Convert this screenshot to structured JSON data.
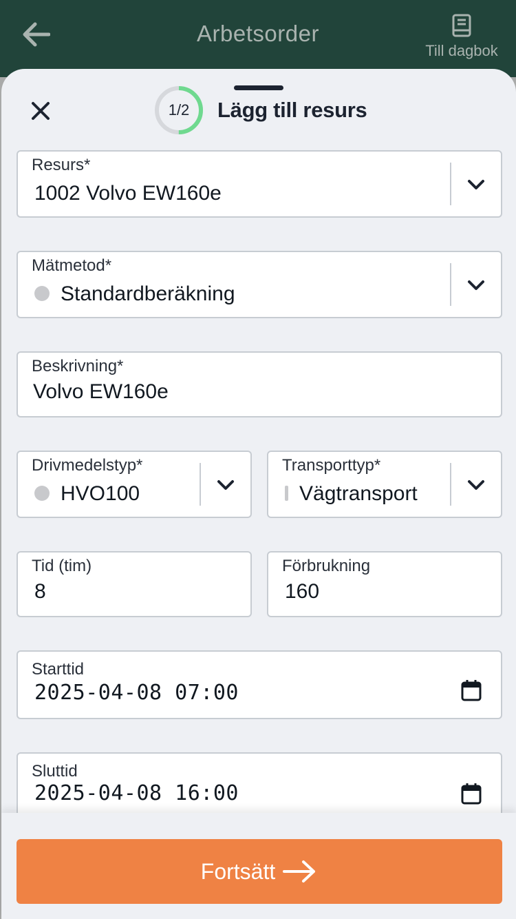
{
  "appbar": {
    "title": "Arbetsorder",
    "back_icon": "arrow-left-icon",
    "diary_label": "Till dagbok",
    "diary_icon": "book-icon"
  },
  "sheet": {
    "step": "1/2",
    "step_progress": 0.5,
    "title": "Lägg till resurs",
    "close_icon": "close-icon"
  },
  "form": {
    "resource": {
      "label": "Resurs*",
      "value": "1002 Volvo EW160e"
    },
    "method": {
      "label": "Mätmetod*",
      "value": "Standardberäkning"
    },
    "description": {
      "label": "Beskrivning*",
      "value": "Volvo EW160e"
    },
    "fuel": {
      "label": "Drivmedelstyp*",
      "value": "HVO100"
    },
    "transport": {
      "label": "Transporttyp*",
      "value": "Vägtransport"
    },
    "time": {
      "label": "Tid (tim)",
      "value": "8"
    },
    "consumption": {
      "label": "Förbrukning",
      "value": "160"
    },
    "start": {
      "label": "Starttid",
      "value": "2025-04-08 07:00"
    },
    "end": {
      "label": "Sluttid",
      "value": "2025-04-08 16:00"
    }
  },
  "footer": {
    "continue_label": "Fortsätt",
    "continue_icon": "arrow-right-icon"
  },
  "colors": {
    "appbar": "#21443a",
    "primary_button": "#ef8244",
    "progress": "#6fd98f",
    "sheet_bg": "#eef0f4"
  }
}
